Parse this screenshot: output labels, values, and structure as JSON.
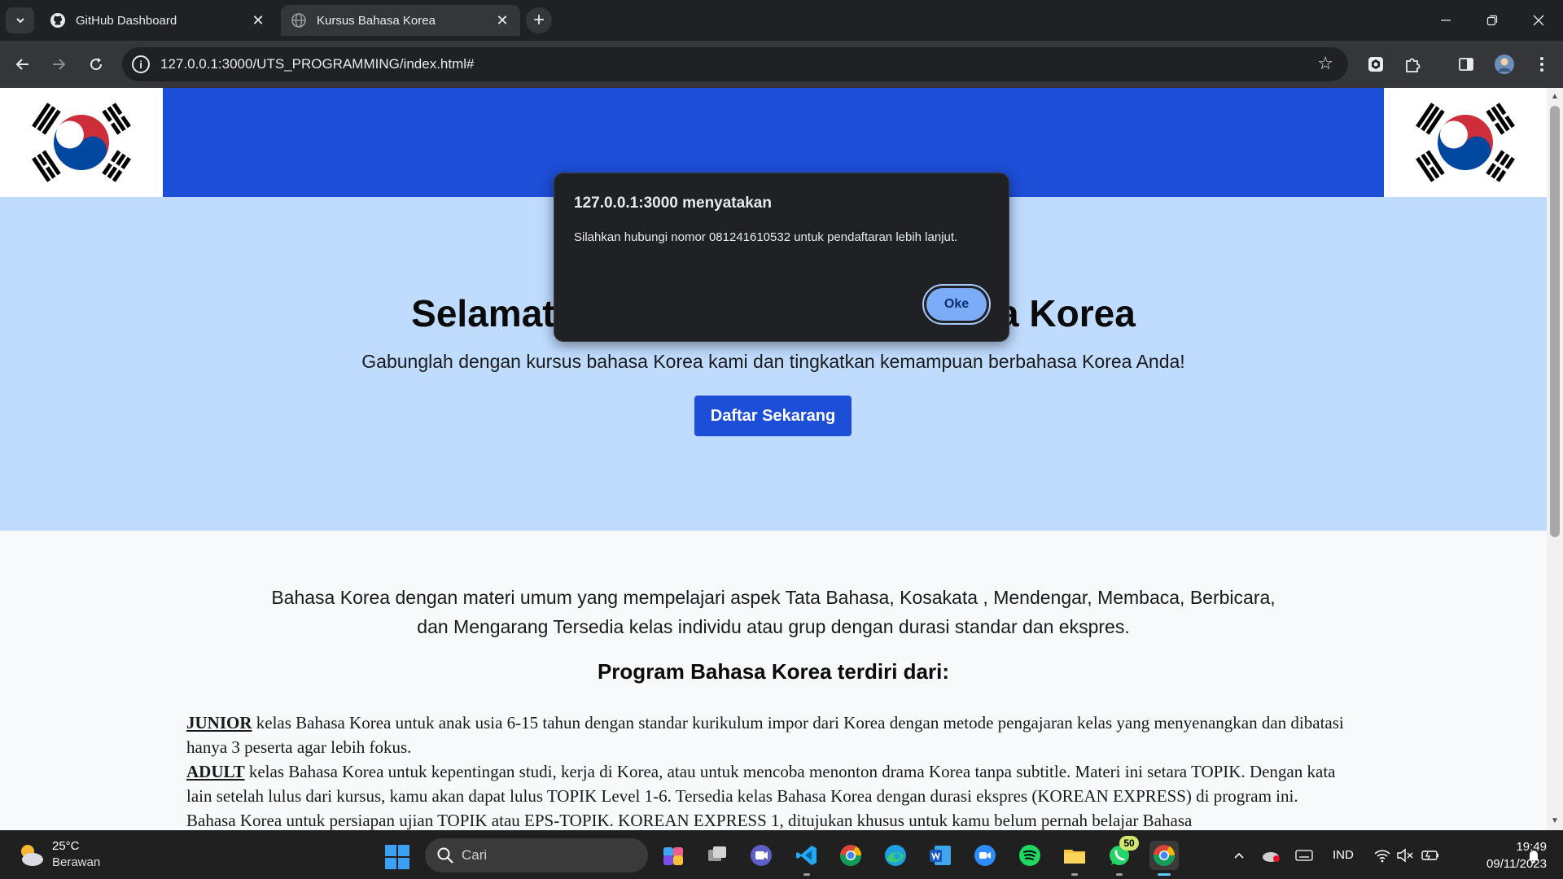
{
  "browser": {
    "tabs": [
      {
        "title": "GitHub Dashboard",
        "active": false,
        "icon": "github-icon"
      },
      {
        "title": "Kursus Bahasa Korea",
        "active": true,
        "icon": "globe-icon"
      }
    ],
    "url": "127.0.0.1:3000/UTS_PROGRAMMING/index.html#"
  },
  "page": {
    "hero_title": "Selamat Datang di Kursus Bahasa Korea",
    "hero_subtitle": "Gabunglah dengan kursus bahasa Korea kami dan tingkatkan kemampuan berbahasa Korea Anda!",
    "cta_label": "Daftar Sekarang",
    "intro": "Bahasa Korea dengan materi umum yang mempelajari aspek Tata Bahasa, Kosakata , Mendengar, Membaca, Berbicara, dan Mengarang Tersedia kelas individu atau grup dengan durasi standar dan ekspres.",
    "program_title": "Program Bahasa Korea terdiri dari:",
    "programs": [
      {
        "name": "JUNIOR",
        "text": " kelas Bahasa Korea untuk anak usia 6-15 tahun dengan standar kurikulum impor dari Korea dengan metode pengajaran kelas yang menyenangkan dan dibatasi hanya 3 peserta agar lebih fokus."
      },
      {
        "name": "ADULT",
        "text": " kelas Bahasa Korea untuk kepentingan studi, kerja di Korea, atau untuk mencoba menonton drama Korea tanpa subtitle. Materi ini setara TOPIK. Dengan kata lain setelah lulus dari kursus, kamu akan dapat lulus TOPIK Level 1-6. Tersedia kelas Bahasa Korea dengan durasi ekspres (KOREAN EXPRESS) di program ini. Bahasa Korea untuk persiapan ujian TOPIK atau EPS-TOPIK. KOREAN EXPRESS 1, ditujukan khusus untuk kamu belum pernah belajar Bahasa"
      }
    ]
  },
  "alert": {
    "title": "127.0.0.1:3000 menyatakan",
    "message": "Silahkan hubungi nomor 081241610532 untuk pendaftaran lebih lanjut.",
    "ok_label": "Oke"
  },
  "taskbar": {
    "weather_temp": "25°C",
    "weather_cond": "Berawan",
    "search_placeholder": "Cari",
    "whatsapp_badge": "50",
    "language": "IND",
    "time": "19:49",
    "date": "09/11/2023"
  },
  "colors": {
    "header_blue": "#1d4ed8",
    "hero_bg": "#bfdbfe",
    "flag_red": "#cd2e3a",
    "flag_blue": "#0047a0"
  }
}
